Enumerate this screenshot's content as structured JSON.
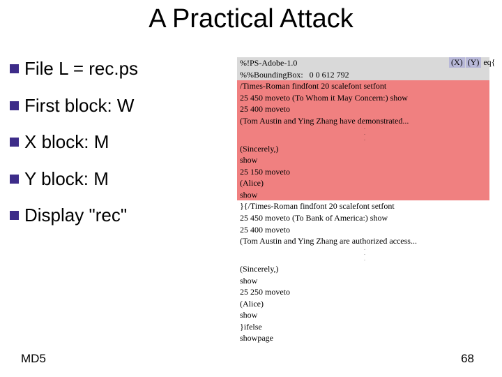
{
  "title": "A Practical Attack",
  "bullets": [
    "File L = rec.ps",
    "First block: W",
    "X block: M",
    "Y block: M",
    "Display \"rec\""
  ],
  "footer": {
    "left": "MD5",
    "right": "68"
  },
  "xy": {
    "x": "(X)",
    "y": "(Y)",
    "tail": "eq{"
  },
  "code": {
    "l0": "%!PS-Adobe-1.0",
    "l1": "%%BoundingBox:   0 0 612 792",
    "l2": "/Times-Roman findfont 20 scalefont setfont",
    "l3": "25 450 moveto (To Whom it May Concern:) show",
    "l4": "25 400 moveto",
    "l5": "(Tom Austin and Ying Zhang have demonstrated...",
    "l6": "(Sincerely,)",
    "l7": "show",
    "l8": "25 150 moveto",
    "l9": "(Alice)",
    "l10": "show",
    "l11": "}{/Times-Roman findfont 20 scalefont setfont",
    "l12": "25 450 moveto (To Bank of America:) show",
    "l13": "25 400 moveto",
    "l14": "(Tom Austin and Ying Zhang are authorized access...",
    "l15": "(Sincerely,)",
    "l16": "show",
    "l17": "25 250 moveto",
    "l18": "(Alice)",
    "l19": "show",
    "l20": "}ifelse",
    "l21": "showpage"
  }
}
